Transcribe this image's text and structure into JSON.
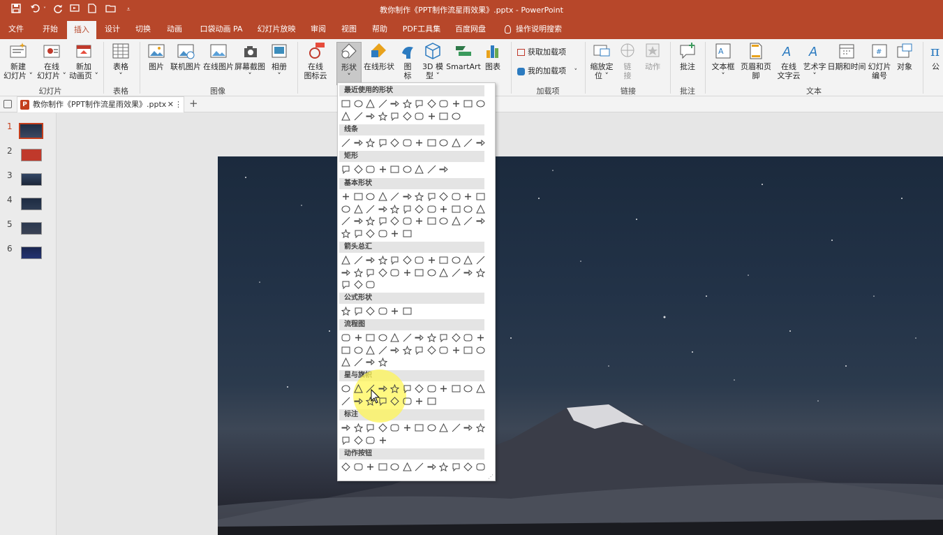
{
  "app": {
    "title": "教你制作《PPT制作流星雨效果》.pptx  -  PowerPoint"
  },
  "quick_access": {
    "save_icon": "save-icon",
    "undo_icon": "undo-icon",
    "redo_icon": "repeat-icon",
    "new_icon": "new-doc-icon",
    "open_icon": "open-icon",
    "customize_icon": "customize-icon"
  },
  "tabs": [
    {
      "label": "文件"
    },
    {
      "label": "开始"
    },
    {
      "label": "插入",
      "active": true
    },
    {
      "label": "设计"
    },
    {
      "label": "切换"
    },
    {
      "label": "动画"
    },
    {
      "label": "口袋动画 PA"
    },
    {
      "label": "幻灯片放映"
    },
    {
      "label": "审阅"
    },
    {
      "label": "视图"
    },
    {
      "label": "帮助"
    },
    {
      "label": "PDF工具集"
    },
    {
      "label": "百度网盘"
    },
    {
      "label": "操作说明搜索"
    }
  ],
  "ribbon": {
    "buttons": [
      {
        "line1": "新建",
        "line2": "幻灯片 ˅"
      },
      {
        "line1": "在线",
        "line2": "幻灯片 ˅"
      },
      {
        "line1": "新加",
        "line2": "动画页 ˅"
      },
      {
        "line1": "表格",
        "line2": "˅"
      },
      {
        "line1": "图片",
        "line2": ""
      },
      {
        "line1": "联机图片",
        "line2": ""
      },
      {
        "line1": "在线图片",
        "line2": ""
      },
      {
        "line1": "屏幕截图",
        "line2": "˅"
      },
      {
        "line1": "相册",
        "line2": "˅"
      },
      {
        "line1": "在线",
        "line2": "图标云"
      },
      {
        "line1": "形状",
        "line2": "˅"
      },
      {
        "line1": "在线形状",
        "line2": ""
      },
      {
        "line1": "图",
        "line2": "标"
      },
      {
        "line1": "3D 模",
        "line2": "型 ˅"
      },
      {
        "line1": "SmartArt",
        "line2": ""
      },
      {
        "line1": "图表",
        "line2": ""
      },
      {
        "line1": "缩放定",
        "line2": "位 ˅"
      },
      {
        "line1": "链",
        "line2": "接"
      },
      {
        "line1": "动作",
        "line2": ""
      },
      {
        "line1": "批注",
        "line2": ""
      },
      {
        "line1": "文本框",
        "line2": "˅"
      },
      {
        "line1": "页眉和页脚",
        "line2": ""
      },
      {
        "line1": "在线",
        "line2": "文字云"
      },
      {
        "line1": "艺术字",
        "line2": "˅"
      },
      {
        "line1": "日期和时间",
        "line2": ""
      },
      {
        "line1": "幻灯片",
        "line2": "编号"
      },
      {
        "line1": "对象",
        "line2": ""
      },
      {
        "line1": "公",
        "line2": ""
      }
    ],
    "small_buttons": [
      {
        "label": "获取加载项"
      },
      {
        "label": "我的加载项"
      }
    ],
    "groups": [
      {
        "label": "幻灯片"
      },
      {
        "label": "表格"
      },
      {
        "label": "图像"
      },
      {
        "label": "加载项"
      },
      {
        "label": "链接"
      },
      {
        "label": "批注"
      },
      {
        "label": "文本"
      }
    ]
  },
  "document_tab": {
    "label": "教你制作《PPT制作流星雨效果》.pptx",
    "close": "✕",
    "more": "⋮",
    "add": "+"
  },
  "slides": [
    {
      "number": "1",
      "selected": true,
      "color": "#2a3a55"
    },
    {
      "number": "2",
      "selected": false,
      "color": "#c0392b"
    },
    {
      "number": "3",
      "selected": false,
      "color": "#3b4d6b"
    },
    {
      "number": "4",
      "selected": false,
      "color": "#253550"
    },
    {
      "number": "5",
      "selected": false,
      "color": "#2e3b55"
    },
    {
      "number": "6",
      "selected": false,
      "color": "#1f2e60"
    }
  ],
  "shapes_menu": {
    "sections": [
      {
        "title": "最近使用的形状",
        "count": 22
      },
      {
        "title": "线条",
        "count": 12
      },
      {
        "title": "矩形",
        "count": 9
      },
      {
        "title": "基本形状",
        "count": 42
      },
      {
        "title": "箭头总汇",
        "count": 27
      },
      {
        "title": "公式形状",
        "count": 6
      },
      {
        "title": "流程图",
        "count": 28
      },
      {
        "title": "星与旗帜",
        "count": 20
      },
      {
        "title": "标注",
        "count": 16
      },
      {
        "title": "动作按钮",
        "count": 12
      }
    ]
  },
  "colors": {
    "accent": "#b7472a",
    "ribbon": "#f3f3f3",
    "selected_slide_border": "#c43e1c"
  }
}
